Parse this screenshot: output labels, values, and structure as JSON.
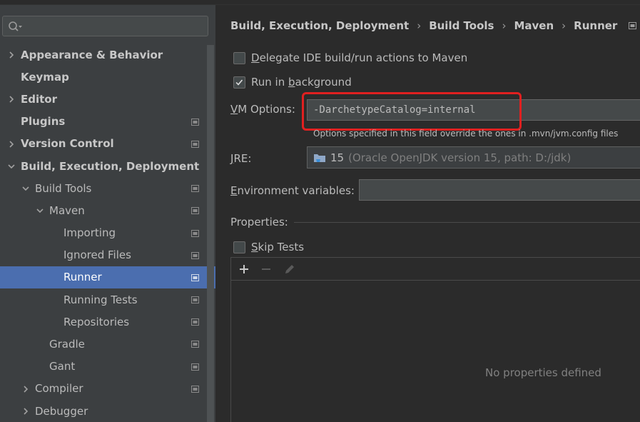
{
  "search": {
    "placeholder": "",
    "value": ""
  },
  "sidebar": {
    "items": [
      {
        "label": "Appearance & Behavior",
        "bold": true,
        "level": 0,
        "chevron": "right",
        "proj": false
      },
      {
        "label": "Keymap",
        "bold": true,
        "level": 0,
        "chevron": "none",
        "proj": false
      },
      {
        "label": "Editor",
        "bold": true,
        "level": 0,
        "chevron": "right",
        "proj": false
      },
      {
        "label": "Plugins",
        "bold": true,
        "level": 0,
        "chevron": "none",
        "proj": true
      },
      {
        "label": "Version Control",
        "bold": true,
        "level": 0,
        "chevron": "right",
        "proj": true
      },
      {
        "label": "Build, Execution, Deployment",
        "bold": true,
        "level": 0,
        "chevron": "down",
        "proj": false
      },
      {
        "label": "Build Tools",
        "bold": false,
        "level": 1,
        "chevron": "down",
        "proj": true
      },
      {
        "label": "Maven",
        "bold": false,
        "level": 2,
        "chevron": "down",
        "proj": true
      },
      {
        "label": "Importing",
        "bold": false,
        "level": 3,
        "chevron": "none",
        "proj": true
      },
      {
        "label": "Ignored Files",
        "bold": false,
        "level": 3,
        "chevron": "none",
        "proj": true
      },
      {
        "label": "Runner",
        "bold": false,
        "level": 3,
        "chevron": "none",
        "proj": true,
        "selected": true
      },
      {
        "label": "Running Tests",
        "bold": false,
        "level": 3,
        "chevron": "none",
        "proj": true
      },
      {
        "label": "Repositories",
        "bold": false,
        "level": 3,
        "chevron": "none",
        "proj": true
      },
      {
        "label": "Gradle",
        "bold": false,
        "level": 2,
        "chevron": "none",
        "proj": true
      },
      {
        "label": "Gant",
        "bold": false,
        "level": 2,
        "chevron": "none",
        "proj": true
      },
      {
        "label": "Compiler",
        "bold": false,
        "level": 1,
        "chevron": "right",
        "proj": true
      },
      {
        "label": "Debugger",
        "bold": false,
        "level": 1,
        "chevron": "right",
        "proj": false
      }
    ]
  },
  "breadcrumb": {
    "items": [
      "Build, Execution, Deployment",
      "Build Tools",
      "Maven",
      "Runner"
    ],
    "separator": "›"
  },
  "options": {
    "delegate": {
      "pre": "",
      "mnemonic": "D",
      "post": "elegate IDE build/run actions to Maven",
      "checked": false
    },
    "background": {
      "pre": "Run in ",
      "mnemonic": "b",
      "post": "ackground",
      "checked": true
    },
    "vm": {
      "mnemonic": "V",
      "label_rest": "M Options:",
      "value": "-DarchetypeCatalog=internal",
      "hint": "Options specified in this field override the ones in .mvn/jvm.config files"
    },
    "jre": {
      "mnemonic": "J",
      "label_rest": "RE:",
      "version": "15",
      "detail": "(Oracle OpenJDK version 15, path: D:/jdk)"
    },
    "env": {
      "pre": "",
      "mnemonic": "E",
      "label_rest": "nvironment variables:",
      "value": ""
    },
    "properties_label": "Properties:",
    "skip_tests": {
      "mnemonic": "S",
      "post": "kip Tests",
      "checked": false
    },
    "empty_text": "No properties defined"
  },
  "colors": {
    "selection": "#4b6eaf",
    "highlight": "#e02020",
    "background": "#2b2b2b",
    "sidebar": "#3c3f41"
  }
}
